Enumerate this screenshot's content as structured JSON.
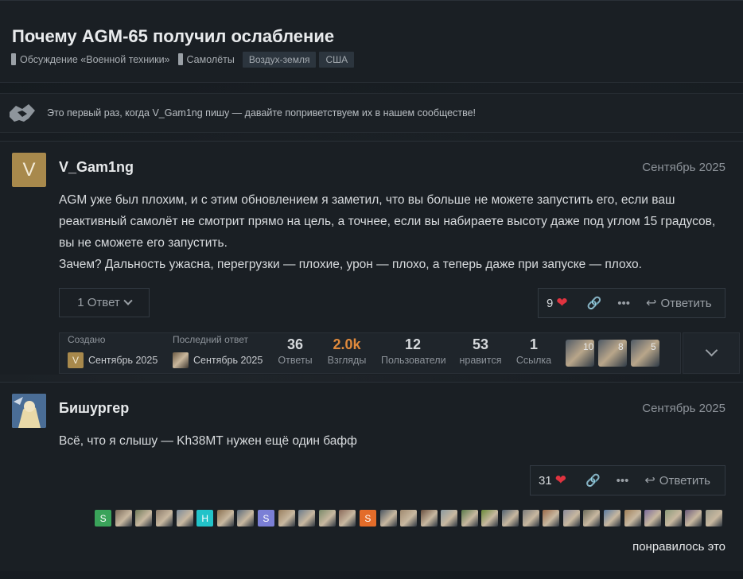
{
  "topic": {
    "title": "Почему AGM-65 получил ослабление",
    "category_1": "Обсуждение «Военной техники»",
    "category_2": "Самолёты",
    "tags": [
      "Воздух-земля",
      "США"
    ]
  },
  "welcome": {
    "text": "Это первый раз, когда V_Gam1ng пишу — давайте поприветствуем их в нашем сообществе!",
    "icon": "handshake-icon"
  },
  "posts": [
    {
      "avatar_letter": "V",
      "avatar_color": "#a8894c",
      "username": "V_Gam1ng",
      "date": "Сентябрь 2025",
      "body": [
        "AGM уже был плохим, и с этим обновлением я заметил, что вы больше не можете запустить его, если ваш реактивный самолёт не смотрит прямо на цель, а точнее, если вы набираете высоту даже под углом 15 градусов, вы не сможете его запустить.",
        "Зачем? Дальность ужасна, перегрузки — плохие, урон — плохо, а теперь даже при запуске — плохо."
      ],
      "replies_label": "1 Ответ",
      "likes": "9",
      "reply_label": "Ответить"
    },
    {
      "username": "Бишургер",
      "date": "Сентябрь 2025",
      "body": [
        "Всё, что я слышу — Kh38MT нужен ещё один бафф"
      ],
      "likes": "31",
      "reply_label": "Ответить",
      "liked_text": "понравилось это"
    }
  ],
  "topic_map": {
    "created_label": "Создано",
    "created_avatar": "V",
    "created_date": "Сентябрь 2025",
    "last_label": "Последний ответ",
    "last_date": "Сентябрь 2025",
    "stats": [
      {
        "num": "36",
        "label": "Ответы"
      },
      {
        "num": "2.0k",
        "label": "Взгляды"
      },
      {
        "num": "12",
        "label": "Пользователи"
      },
      {
        "num": "53",
        "label": "нравится"
      },
      {
        "num": "1",
        "label": "Ссылка"
      }
    ],
    "participants": [
      "10",
      "8",
      "5"
    ]
  },
  "likers": [
    {
      "letter": "S",
      "color": "#3aa35a"
    },
    {
      "color": "#7a6a5a"
    },
    {
      "color": "#6f7a5a"
    },
    {
      "color": "#8a7a6a"
    },
    {
      "color": "#7a8a9a"
    },
    {
      "letter": "H",
      "color": "#22c3c9"
    },
    {
      "color": "#8a7050"
    },
    {
      "color": "#5a6a7a"
    },
    {
      "letter": "S",
      "color": "#7b7fd6"
    },
    {
      "color": "#9a8060"
    },
    {
      "color": "#6a7a8a"
    },
    {
      "color": "#7a8a6a"
    },
    {
      "color": "#8a6a5a"
    },
    {
      "letter": "S",
      "color": "#e36c2a"
    },
    {
      "color": "#4a5560"
    },
    {
      "color": "#a08a70"
    },
    {
      "color": "#6a5040"
    },
    {
      "color": "#8a9aa0"
    },
    {
      "color": "#5a7a4a"
    },
    {
      "color": "#6a8a3a"
    },
    {
      "color": "#506070"
    },
    {
      "color": "#7a7a7a"
    },
    {
      "color": "#9a6a4a"
    },
    {
      "color": "#8a8a9a"
    },
    {
      "color": "#6a6a5a"
    },
    {
      "color": "#5a7aa0"
    },
    {
      "color": "#a0805a"
    },
    {
      "color": "#7a6a9a"
    },
    {
      "color": "#8a9a7a"
    },
    {
      "color": "#6a5a7a"
    },
    {
      "color": "#9a9a8a"
    }
  ],
  "colors": {
    "heart": "#e0333f",
    "views_hot": "#e08a3c",
    "background": "#161b20"
  }
}
